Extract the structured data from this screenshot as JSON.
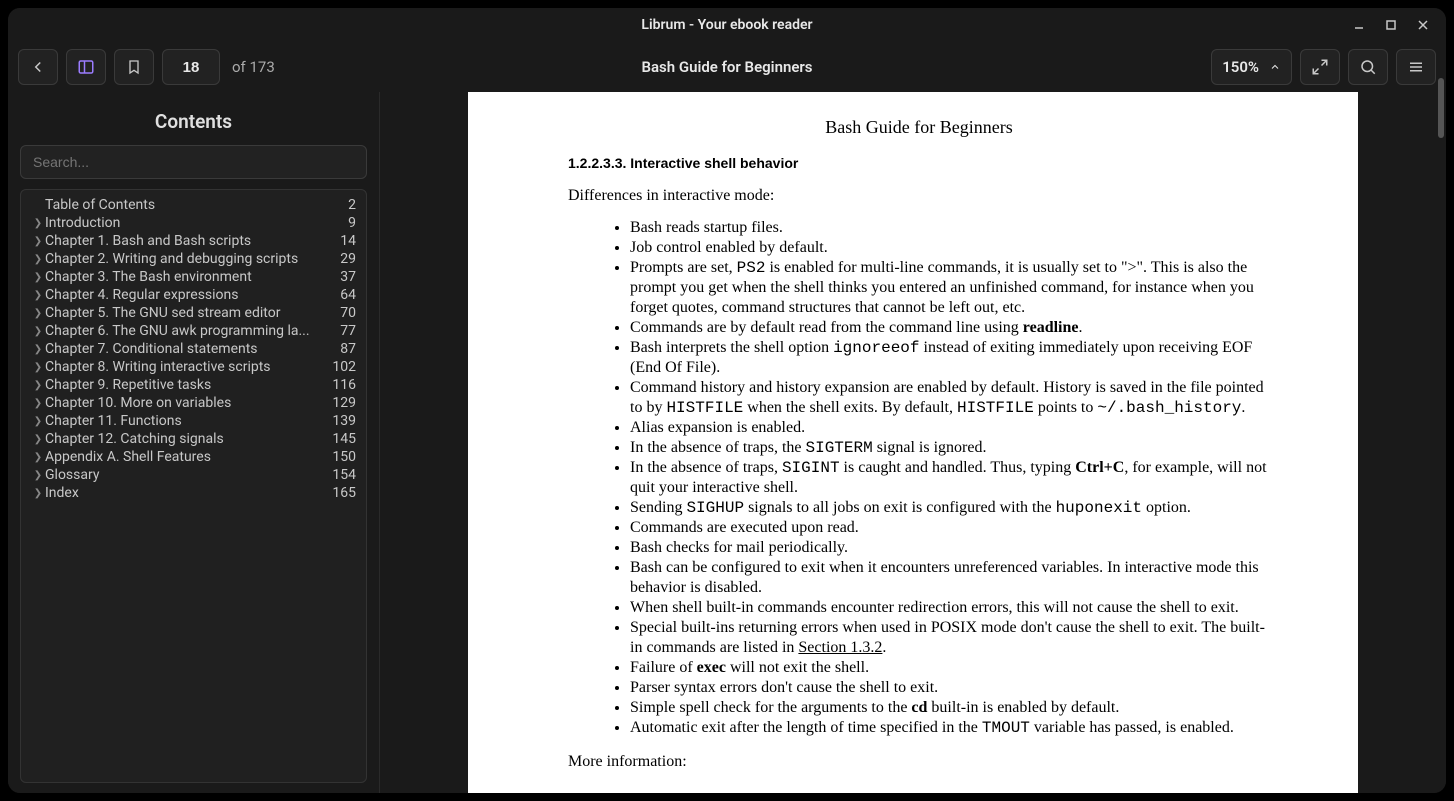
{
  "window_title": "Librum - Your ebook reader",
  "toolbar": {
    "page_current": "18",
    "page_total_label": "of 173",
    "book_title": "Bash Guide for Beginners",
    "zoom_label": "150%"
  },
  "sidebar": {
    "heading": "Contents",
    "search_placeholder": "Search...",
    "toc": [
      {
        "label": "Table of Contents",
        "page": "2",
        "chev": false
      },
      {
        "label": "Introduction",
        "page": "9",
        "chev": true
      },
      {
        "label": "Chapter 1. Bash and Bash scripts",
        "page": "14",
        "chev": true
      },
      {
        "label": "Chapter 2. Writing and debugging scripts",
        "page": "29",
        "chev": true
      },
      {
        "label": "Chapter 3. The Bash environment",
        "page": "37",
        "chev": true
      },
      {
        "label": "Chapter 4. Regular expressions",
        "page": "64",
        "chev": true
      },
      {
        "label": "Chapter 5. The GNU sed stream editor",
        "page": "70",
        "chev": true
      },
      {
        "label": "Chapter 6. The GNU awk programming la...",
        "page": "77",
        "chev": true
      },
      {
        "label": "Chapter 7. Conditional statements",
        "page": "87",
        "chev": true
      },
      {
        "label": "Chapter 8. Writing interactive scripts",
        "page": "102",
        "chev": true
      },
      {
        "label": "Chapter 9. Repetitive tasks",
        "page": "116",
        "chev": true
      },
      {
        "label": "Chapter 10. More on variables",
        "page": "129",
        "chev": true
      },
      {
        "label": "Chapter 11. Functions",
        "page": "139",
        "chev": true
      },
      {
        "label": "Chapter 12. Catching signals",
        "page": "145",
        "chev": true
      },
      {
        "label": "Appendix A. Shell Features",
        "page": "150",
        "chev": true
      },
      {
        "label": "Glossary",
        "page": "154",
        "chev": true
      },
      {
        "label": "Index",
        "page": "165",
        "chev": true
      }
    ]
  },
  "page": {
    "header": "Bash Guide for Beginners",
    "section_heading": "1.2.2.3.3. Interactive shell behavior",
    "intro": "Differences in interactive mode:",
    "bullets_html": [
      "Bash reads startup files.",
      "Job control enabled by default.",
      "Prompts are set, <code class='mono'>PS2</code> is enabled for multi-line commands, it is usually set to \">\". This is also the prompt you get when the shell thinks you entered an unfinished command, for instance when you forget quotes, command structures that cannot be left out, etc.",
      "Commands are by default read from the command line using <b>readline</b>.",
      "Bash interprets the shell option <code class='mono'>ignoreeof</code> instead of exiting immediately upon receiving EOF (End Of File).",
      "Command history and history expansion are enabled by default. History is saved in the file pointed to by <code class='mono'>HISTFILE</code> when the shell exits. By default, <code class='mono'>HISTFILE</code> points to <code class='mono'>~/.bash_history</code>.",
      "Alias expansion is enabled.",
      "In the absence of traps, the <code class='mono'>SIGTERM</code> signal is ignored.",
      "In the absence of traps, <code class='mono'>SIGINT</code> is caught and handled. Thus, typing <b>Ctrl+C</b>, for example, will not quit your interactive shell.",
      "Sending <code class='mono'>SIGHUP</code> signals to all jobs on exit is configured with the <code class='mono'>huponexit</code> option.",
      "Commands are executed upon read.",
      "Bash checks for mail periodically.",
      "Bash can be configured to exit when it encounters unreferenced variables. In interactive mode this behavior is disabled.",
      "When shell built-in commands encounter redirection errors, this will not cause the shell to exit.",
      "Special built-ins returning errors when used in POSIX mode don't cause the shell to exit. The built-in commands are listed in <span class='ul'>Section 1.3.2</span>.",
      "Failure of <b>exec</b> will not exit the shell.",
      "Parser syntax errors don't cause the shell to exit.",
      "Simple spell check for the arguments to the <b>cd</b> built-in is enabled by default.",
      "Automatic exit after the length of time specified in the <code class='mono'>TMOUT</code> variable has passed, is enabled."
    ],
    "outro": "More information:"
  }
}
